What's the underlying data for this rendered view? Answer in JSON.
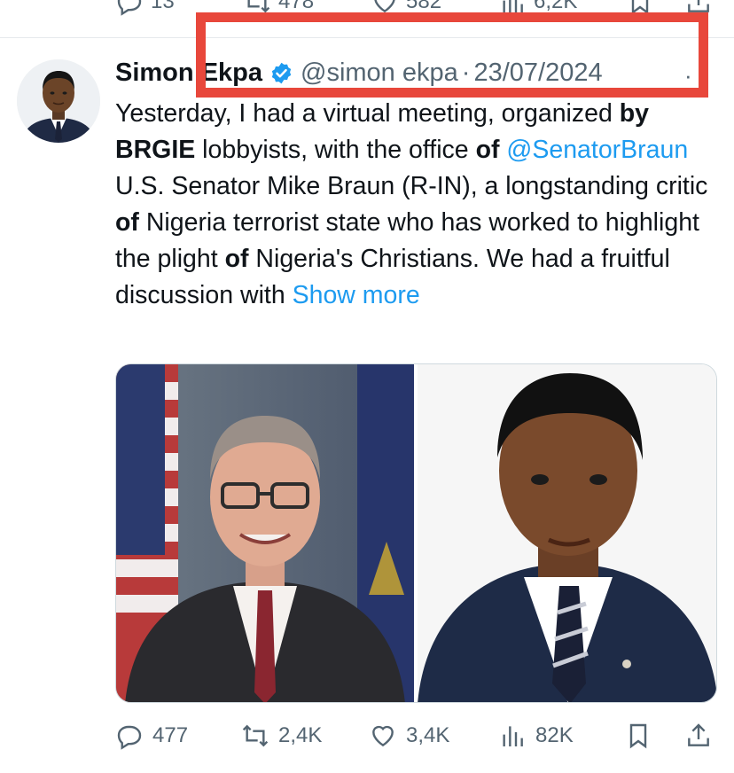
{
  "prev_tweet": {
    "replies": "13",
    "retweets": "478",
    "likes": "582",
    "views": "6,2K"
  },
  "tweet": {
    "author": {
      "first_name": "Simon",
      "last_name": "Ekpa",
      "handle": "@simon ekpa",
      "separator": "·",
      "date": "23/07/2024",
      "verified_icon": "verified-badge-icon"
    },
    "text": {
      "p1": "Yesterday, I had a virtual meeting, organized ",
      "b1": "by",
      "p2": " ",
      "b2": "BRGIE",
      "p3": " lobbyists, with the office ",
      "b3": "of",
      "p4": " ",
      "link1": "@SenatorBraun",
      "p5": " U.S. Senator Mike Braun (R-IN), a longstanding critic ",
      "b4": "of",
      "p6": " Nigeria terrorist state who has worked to highlight the plight ",
      "b5": "of",
      "p7": " Nigeria's Christians. We had a fruitful discussion with ",
      "show_more": "Show more"
    },
    "stats": {
      "replies": "477",
      "retweets": "2,4K",
      "likes": "3,4K",
      "views": "82K"
    }
  },
  "colors": {
    "highlight_box": "#e8473b",
    "link": "#1d9bf0",
    "verified": "#1d9bf0",
    "muted_text": "#536471"
  }
}
